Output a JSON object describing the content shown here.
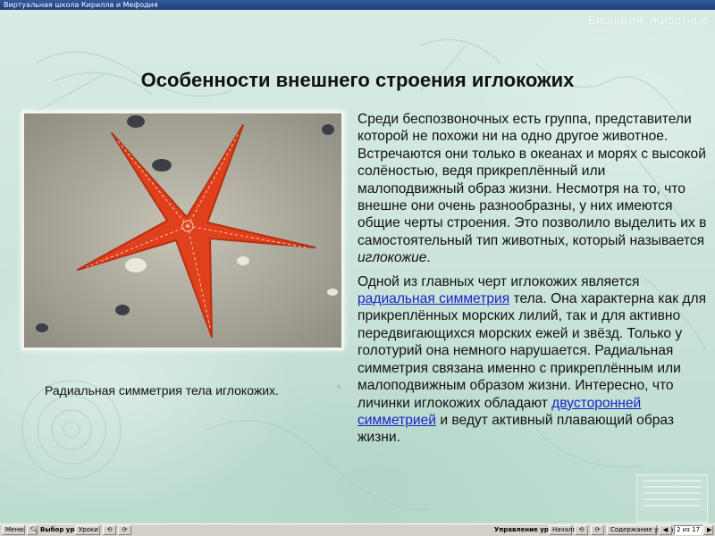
{
  "window": {
    "title": "Виртуальная школа Кирилла и Мефодия"
  },
  "header": {
    "subject": "Биология. Животные"
  },
  "slide": {
    "title": "Особенности внешнего строения иглокожих",
    "caption": "Радиальная симметрия тела иглокожих.",
    "p1_text": "Среди беспозвоночных есть группа, представители которой не похожи ни на одно другое животное. Встречаются они только в океанах и морях с высокой солёностью, ведя прикреплённый или малоподвижный образ жизни. Несмотря на то, что внешне они очень разнообразны, у них имеются общие черты строения. Это позволило выделить их в самостоятельный тип животных, который называется ",
    "p1_term": "иглокожие",
    "p1_end": ".",
    "p2_start": "Одной из главных черт иглокожих является ",
    "p2_link1": "радиальная симметрия",
    "p2_mid": " тела. Она характерна как для прикреплённых морских лилий, так и для активно передвигающихся морских ежей и звёзд. Только у голотурий она немного нарушается. Радиальная симметрия связана именно с прикреплённым или малоподвижным образом жизни. Интересно, что личинки иглокожих обладают ",
    "p2_link2": "двусторонней симметрией",
    "p2_end": " и ведут активный плавающий образ жизни."
  },
  "toolbar": {
    "menu_label": "Меню",
    "select_lesson_label": "Выбор урока:",
    "lessons_button": "Уроки",
    "lesson_control_label": "Управление уроком:",
    "start_button": "Начало",
    "contents_button": "Содержание урока",
    "page_indicator": "2 из 17"
  },
  "colors": {
    "accent_link": "#1a22c8",
    "starfish": "#e0401c",
    "titlebar": "#2f5a9a"
  }
}
